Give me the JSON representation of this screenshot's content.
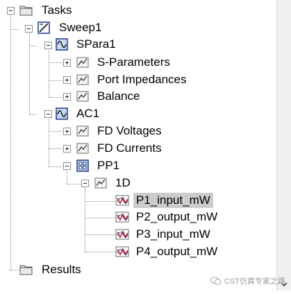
{
  "tree": {
    "tasks": "Tasks",
    "sweep1": "Sweep1",
    "spara1": "SPara1",
    "s_parameters": "S-Parameters",
    "port_impedances": "Port Impedances",
    "balance": "Balance",
    "ac1": "AC1",
    "fd_voltages": "FD Voltages",
    "fd_currents": "FD Currents",
    "pp1": "PP1",
    "d1": "1D",
    "p1_input": "P1_input_mW",
    "p2_output": "P2_output_mW",
    "p3_input": "P3_input_mW",
    "p4_output": "P4_output_mW",
    "results": "Results",
    "selected_item": "P1_input_mW"
  },
  "watermark": {
    "text": "CST仿真专家之路"
  },
  "colors": {
    "folder": "#e8e8e8",
    "icon_frame": "#1f3a8a",
    "icon_fill": "#c8d8ee",
    "curve_red": "#d01818",
    "selection": "#cccccc"
  },
  "icons": {
    "folder": "folder-icon",
    "sweep": "sweep-icon",
    "spara": "sparameter-task-icon",
    "ac": "ac-task-icon",
    "pp": "postprocessing-grid-icon",
    "plot": "plot-folder-icon",
    "result": "result-curve-icon",
    "expand": "expand-plus-icon",
    "collapse": "collapse-minus-icon"
  }
}
